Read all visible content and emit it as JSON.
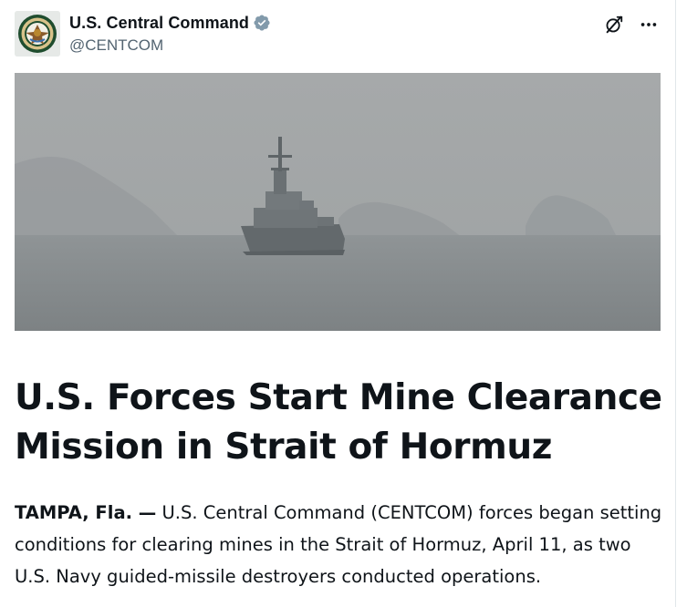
{
  "post": {
    "author": {
      "display_name": "U.S. Central Command",
      "handle": "@CENTCOM",
      "verified_icon": "verified-badge-icon",
      "avatar_icon": "centcom-seal"
    },
    "actions": {
      "grok_icon": "grok-icon",
      "more_icon": "more-options-icon"
    },
    "image": {
      "subject": "naval destroyer at sea in haze",
      "icon": "photo"
    },
    "article": {
      "headline": "U.S. Forces Start Mine Clearance Mission in Strait of Hormuz",
      "dateline": "TAMPA, Fla. —",
      "body": " U.S. Central Command (CENTCOM) forces began setting conditions for clearing mines in the Strait of Hormuz, April 11, as two U.S. Navy guided-missile destroyers conducted operations."
    }
  },
  "colors": {
    "text_primary": "#0f1419",
    "text_secondary": "#536471",
    "verified_gray": "#829aab"
  }
}
